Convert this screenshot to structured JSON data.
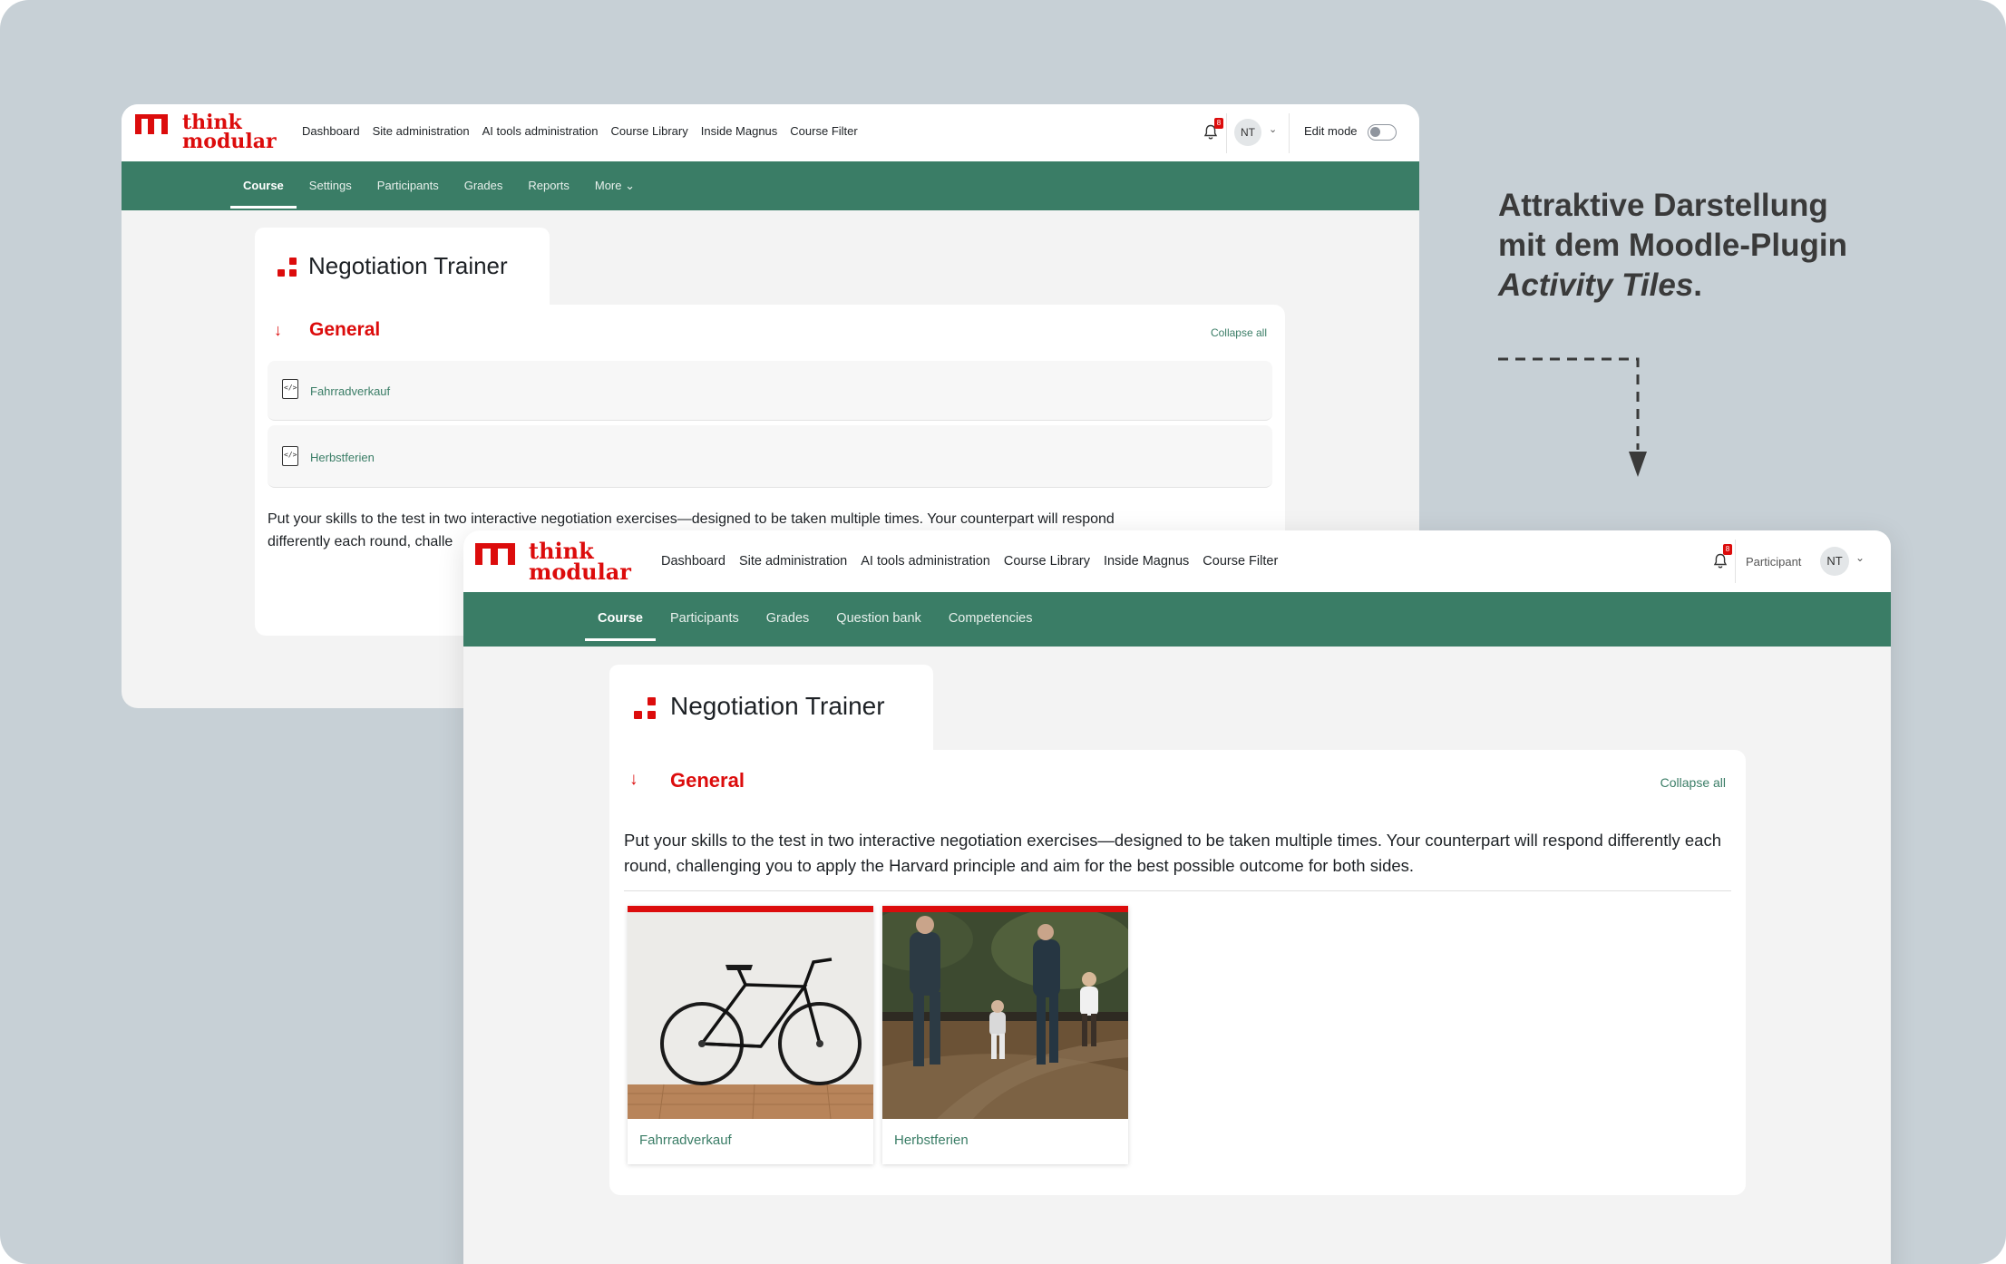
{
  "annotation": {
    "line1": "Attraktive Darstellung",
    "line2": "mit dem Moodle-Plugin",
    "line3_italic": "Activity Tiles",
    "line3_suffix": "."
  },
  "brand": {
    "line1": "think",
    "line2": "modular",
    "color": "#dc0c0c",
    "accent": "#3a7d66"
  },
  "window_back": {
    "nav": [
      "Dashboard",
      "Site administration",
      "AI tools administration",
      "Course Library",
      "Inside Magnus",
      "Course Filter"
    ],
    "notification_count": "8",
    "avatar": "NT",
    "edit_mode_label": "Edit mode",
    "edit_mode_on": false,
    "secondary_nav": [
      "Course",
      "Settings",
      "Participants",
      "Grades",
      "Reports",
      "More"
    ],
    "active_tab": "Course",
    "course_title": "Negotiation Trainer",
    "section_title": "General",
    "collapse_label": "Collapse all",
    "activities": [
      "Fahrradverkauf",
      "Herbstferien"
    ],
    "description_line1": "Put your skills to the test in two interactive negotiation exercises—designed to be taken multiple times. Your counterpart will respond",
    "description_line2": "differently each round, challe"
  },
  "window_front": {
    "nav": [
      "Dashboard",
      "Site administration",
      "AI tools administration",
      "Course Library",
      "Inside Magnus",
      "Course Filter"
    ],
    "notification_count": "8",
    "role_label": "Participant",
    "avatar": "NT",
    "secondary_nav": [
      "Course",
      "Participants",
      "Grades",
      "Question bank",
      "Competencies"
    ],
    "active_tab": "Course",
    "course_title": "Negotiation Trainer",
    "section_title": "General",
    "collapse_label": "Collapse all",
    "description": "Put your skills to the test in two interactive negotiation exercises—designed to be taken multiple times. Your counterpart will respond differently each round, challenging you to apply the Harvard principle and aim for the best possible outcome for both sides.",
    "tiles": [
      {
        "label": "Fahrradverkauf",
        "image": "bicycle-photo"
      },
      {
        "label": "Herbstferien",
        "image": "family-walk-photo"
      }
    ]
  }
}
